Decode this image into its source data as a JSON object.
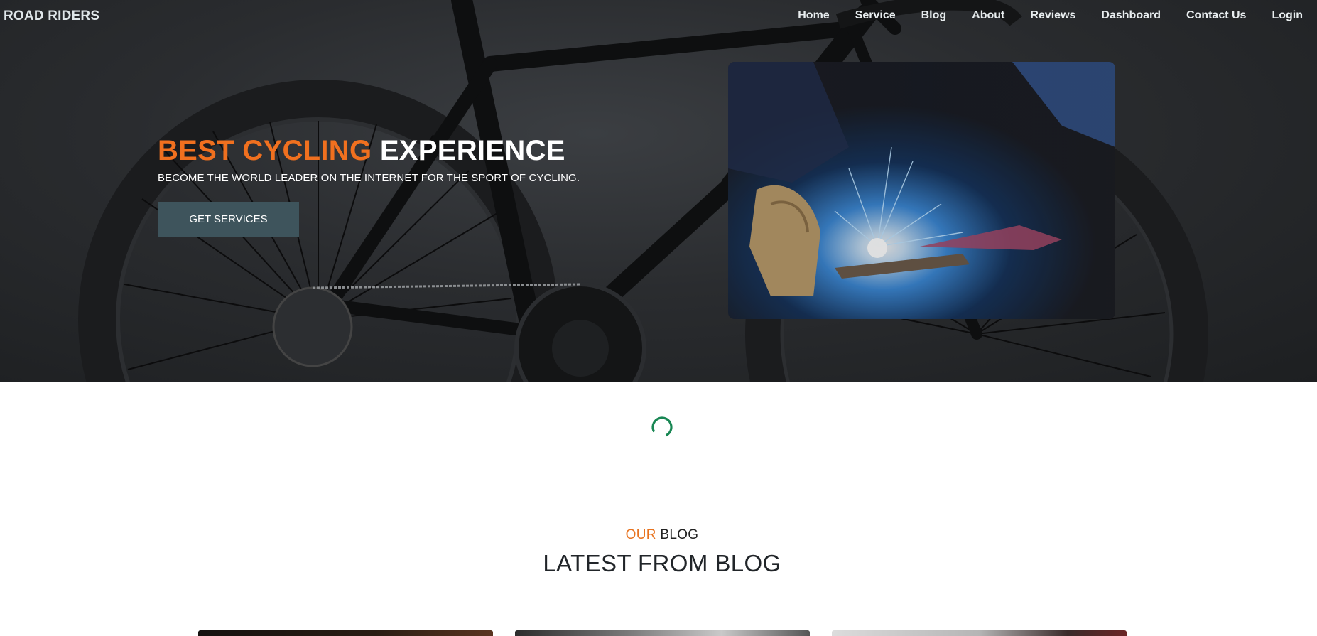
{
  "nav": {
    "brand": "ROAD RIDERS",
    "links": [
      "Home",
      "Service",
      "Blog",
      "About",
      "Reviews",
      "Dashboard",
      "Contact Us",
      "Login"
    ]
  },
  "hero": {
    "headline_accent": "BEST CYCLING",
    "headline_rest": "EXPERIENCE",
    "subtitle": "BECOME THE WORLD LEADER ON THE INTERNET FOR THE SPORT OF CYCLING.",
    "cta_label": "GET SERVICES"
  },
  "blog": {
    "eyebrow_accent": "OUR",
    "eyebrow_rest": "BLOG",
    "title": "LATEST FROM BLOG"
  },
  "colors": {
    "accent": "#f0701f",
    "cta_bg": "#3e545c",
    "spinner": "#198754"
  }
}
